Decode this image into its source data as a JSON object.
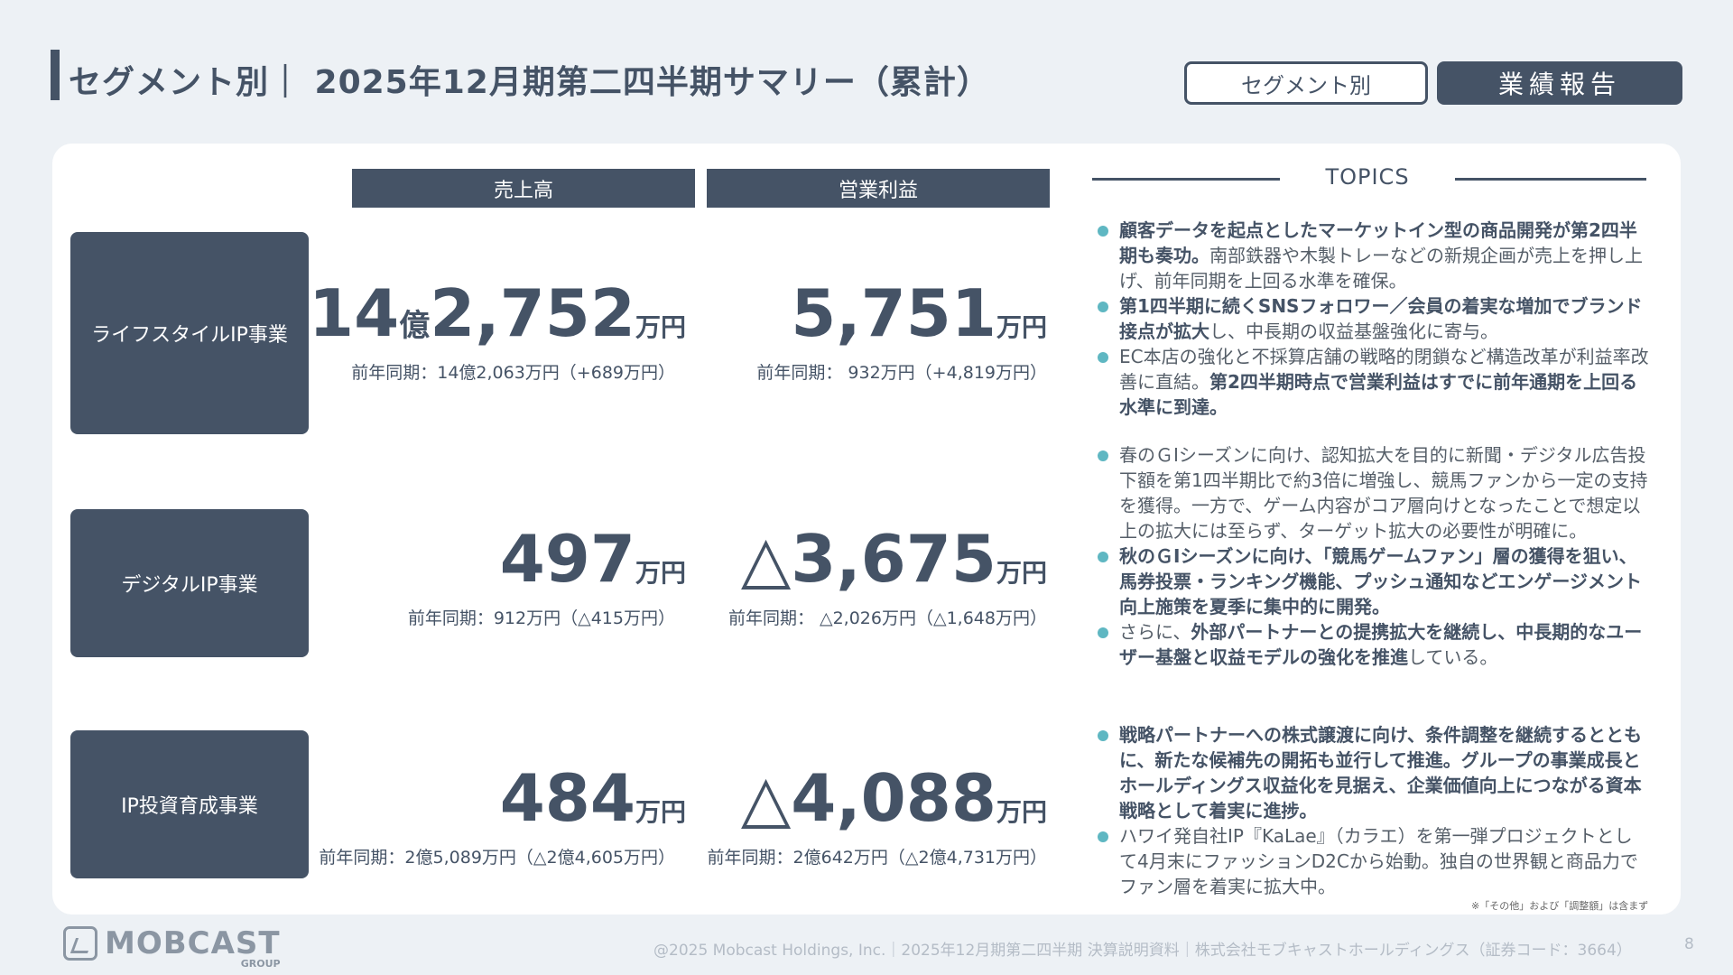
{
  "header": {
    "title": "セグメント別｜ 2025年12月期第二四半期サマリー（累計）",
    "btn_segment": "セグメント別",
    "btn_report": "業績報告"
  },
  "columns": {
    "sales": "売上高",
    "op": "営業利益"
  },
  "segments": [
    {
      "name": "ライフスタイルIP事業",
      "sales_oku": "14",
      "sales_oku_unit": "億",
      "sales_num": "2,752",
      "sales_unit": "万円",
      "sales_prev": "前年同期：14億2,063万円（+689万円）",
      "op_num": "5,751",
      "op_unit": "万円",
      "op_prev": "前年同期： 932万円（+4,819万円）"
    },
    {
      "name": "デジタルIP事業",
      "sales_num": "497",
      "sales_unit": "万円",
      "sales_prev": "前年同期：912万円（△415万円）",
      "op_num": "△3,675",
      "op_unit": "万円",
      "op_prev": "前年同期： △2,026万円（△1,648万円）"
    },
    {
      "name": "IP投資育成事業",
      "sales_num": "484",
      "sales_unit": "万円",
      "sales_prev": "前年同期：2億5,089万円（△2億4,605万円）",
      "op_num": "△4,088",
      "op_unit": "万円",
      "op_prev": "前年同期：2億642万円（△2億4,731万円）"
    }
  ],
  "topics": {
    "label": "TOPICS",
    "g1": [
      {
        "b1": "顧客データを起点としたマーケットイン型の商品開発が第2四半期も奏功。",
        "t1": "南部鉄器や木製トレーなどの新規企画が売上を押し上げ、前年同期を上回る水準を確保。"
      },
      {
        "b1": "第1四半期に続くSNSフォロワー／会員の着実な増加でブランド接点が拡大",
        "t1": "し、中長期の収益基盤強化に寄与。"
      },
      {
        "t1": "EC本店の強化と不採算店舗の戦略的閉鎖など構造改革が利益率改善に直結。",
        "b1": "第2四半期時点で営業利益はすでに前年通期を上回る水準に到達。"
      }
    ],
    "g2": [
      {
        "t1": "春のＧⅠシーズンに向け、認知拡大を目的に新聞・デジタル広告投下額を第1四半期比で約3倍に増強し、競馬ファンから一定の支持を獲得。一方で、ゲーム内容がコア層向けとなったことで想定以上の拡大には至らず、ターゲット拡大の必要性が明確に。"
      },
      {
        "b1": "秋のＧⅠシーズンに向け、「競馬ゲームファン」層の獲得を狙い、馬券投票・ランキング機能、プッシュ通知などエンゲージメント向上施策を夏季に集中的に開発。"
      },
      {
        "t1": "さらに、",
        "b1": "外部パートナーとの提携拡大を継続し、中長期的なユーザー基盤と収益モデルの強化を推進",
        "t2": "している。"
      }
    ],
    "g3": [
      {
        "b1": "戦略パートナーへの株式譲渡に向け、条件調整を継続するとともに、新たな候補先の開拓も並行して推進。グループの事業成長とホールディングス収益化を見据え、企業価値向上につながる資本戦略として着実に進捗。"
      },
      {
        "t1": "ハワイ発自社IP『KaLae』（カラエ）を第一弾プロジェクトとして4月末にファッションD2Cから始動。独自の世界観と商品力でファン層を着実に拡大中。"
      }
    ]
  },
  "note": "※「その他」および「調整額」は含まず",
  "logo": {
    "name": "MOBCAST",
    "sub": "GROUP"
  },
  "footer": "@2025 Mobcast Holdings, Inc.｜2025年12月期第二四半期 決算説明資料｜株式会社モブキャストホールディングス（証券コード：3664）",
  "page_number": "8"
}
